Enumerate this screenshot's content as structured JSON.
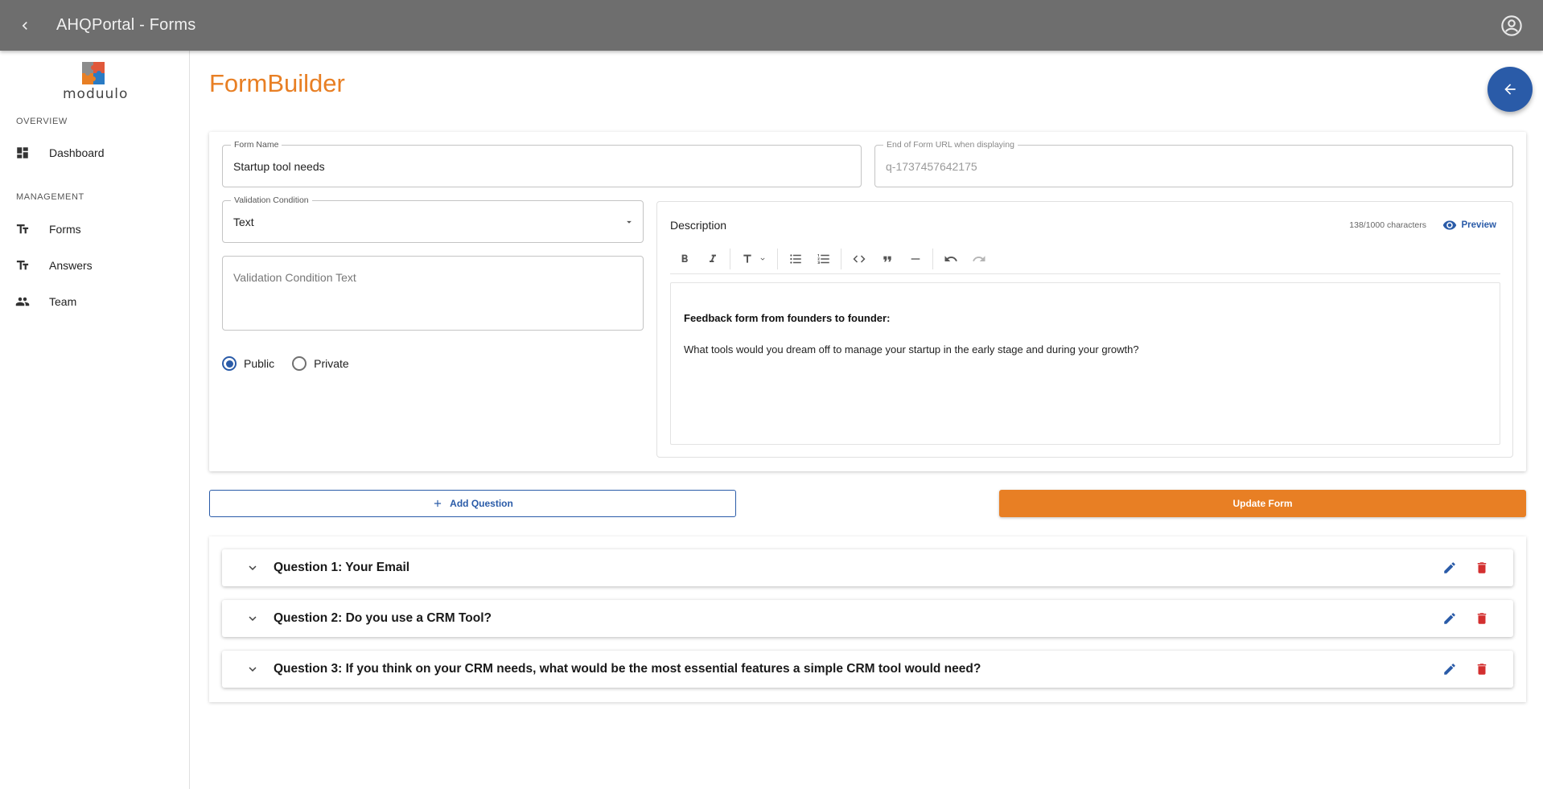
{
  "appbar": {
    "title": "AHQPortal - Forms"
  },
  "sidebar": {
    "logo_text": "moduulo",
    "overview_label": "OVERVIEW",
    "management_label": "MANAGEMENT",
    "items": [
      {
        "label": "Dashboard",
        "icon": "dashboard-icon"
      },
      {
        "label": "Forms",
        "icon": "text-fields-icon"
      },
      {
        "label": "Answers",
        "icon": "text-fields-icon"
      },
      {
        "label": "Team",
        "icon": "people-icon"
      }
    ]
  },
  "page": {
    "title": "FormBuilder"
  },
  "form": {
    "name_label": "Form Name",
    "name_value": "Startup tool needs",
    "url_label": "End of Form URL when displaying",
    "url_value": "q-1737457642175",
    "validation_label": "Validation Condition",
    "validation_value": "Text",
    "validation_text_placeholder": "Validation Condition Text",
    "visibility_options": [
      "Public",
      "Private"
    ],
    "visibility_selected": "Public"
  },
  "description": {
    "title": "Description",
    "char_count": "138/1000 characters",
    "preview_label": "Preview",
    "bold_line": "Feedback form from founders to founder:",
    "paragraph": "What tools would you dream off to manage your startup in the early stage and during your growth?"
  },
  "actions": {
    "add_question": "Add Question",
    "update_form": "Update Form"
  },
  "questions": [
    {
      "label": "Question 1: Your Email"
    },
    {
      "label": "Question 2: Do you use a CRM Tool?"
    },
    {
      "label": "Question 3: If you think on your CRM needs, what would be the most essential features a simple CRM tool would need?"
    }
  ],
  "colors": {
    "accent_orange": "#e87f24",
    "primary_blue": "#2a5ba8",
    "delete_red": "#d32f2f",
    "appbar_gray": "#6e6e6e"
  }
}
